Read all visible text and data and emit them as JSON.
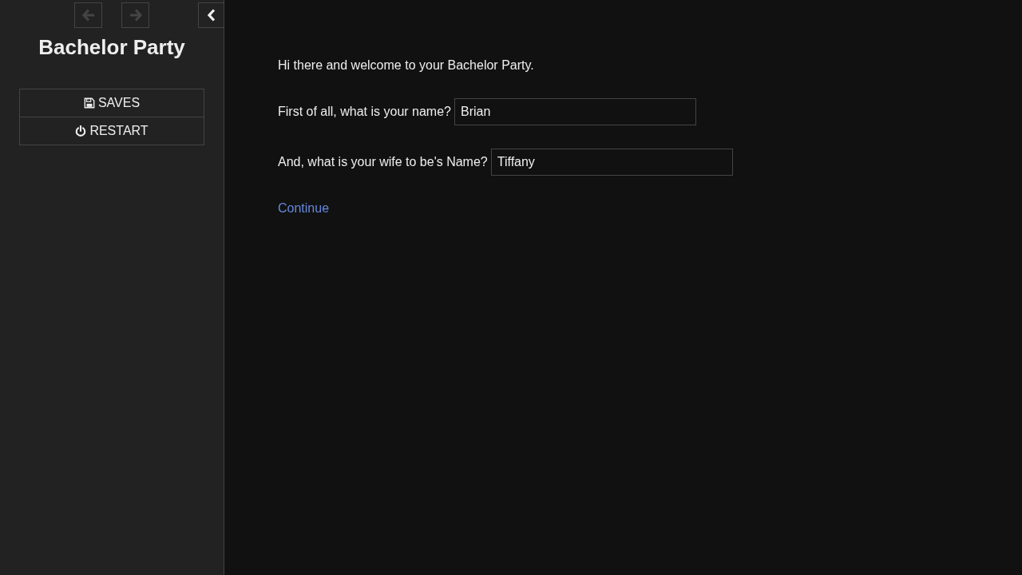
{
  "sidebar": {
    "history": [
      {
        "kind": "back",
        "disabled": true
      },
      {
        "kind": "forward",
        "disabled": true
      }
    ],
    "stowed": false,
    "title": "Bachelor Party",
    "menu": [
      {
        "kind": "saves",
        "label": "SAVES"
      },
      {
        "kind": "restart",
        "label": "RESTART"
      }
    ]
  },
  "passage": [
    {
      "kind": "text",
      "text": "Hi there and welcome to your Bachelor Party."
    },
    {
      "kind": "field",
      "label": "First of all, what is your name?",
      "value": "Brian"
    },
    {
      "kind": "field",
      "label": "And, what is your wife to be's Name?",
      "value": "Tiffany"
    },
    {
      "kind": "link",
      "text": "Continue"
    }
  ]
}
